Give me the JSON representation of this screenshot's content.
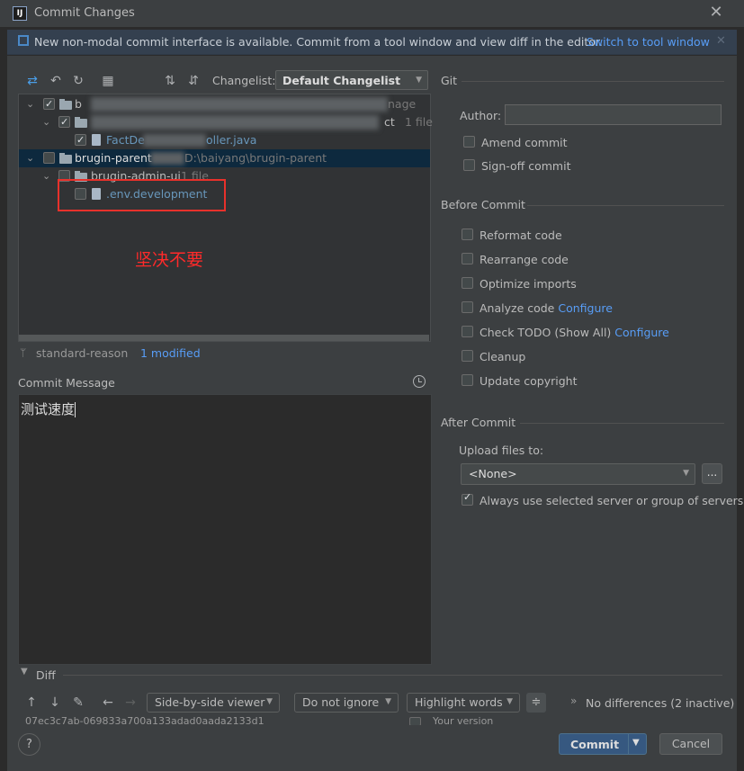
{
  "window": {
    "title": "Commit Changes",
    "app_icon": "IJ"
  },
  "banner": {
    "text": "New non-modal commit interface is available. Commit from a tool window and view diff in the editor.",
    "link": "Switch to tool window"
  },
  "toolbar": {
    "changelist_label": "Changelist:",
    "changelist_value": "Default Changelist"
  },
  "tree": {
    "rows": [
      {
        "text_left": "b",
        "text_right": "nage"
      },
      {
        "text_right": "ct",
        "count": "1 file"
      },
      {
        "file_left": "FactDe",
        "file_right": "oller.java"
      },
      {
        "name": "brugin-parent",
        "path": "D:\\baiyang\\brugin-parent"
      },
      {
        "name": "brugin-admin-ui",
        "count": "1 file"
      },
      {
        "name": ".env.development"
      }
    ]
  },
  "annotation": {
    "text": "坚决不要"
  },
  "status": {
    "branch": "standard-reason",
    "modified": "1 modified"
  },
  "commit_message": {
    "label": "Commit Message",
    "value": "测试速度"
  },
  "git": {
    "section_title": "Git",
    "author_label": "Author:",
    "author_value": "",
    "amend_label": "Amend commit",
    "signoff_label": "Sign-off commit"
  },
  "before_commit": {
    "title": "Before Commit",
    "reformat": "Reformat code",
    "rearrange": "Rearrange code",
    "optimize": "Optimize imports",
    "analyze": "Analyze code",
    "analyze_link": "Configure",
    "todo": "Check TODO (Show All)",
    "todo_link": "Configure",
    "cleanup": "Cleanup",
    "copyright": "Update copyright"
  },
  "after_commit": {
    "title": "After Commit",
    "upload_label": "Upload files to:",
    "upload_value": "<None>",
    "dots": "...",
    "always_label": "Always use selected server or group of servers"
  },
  "diff": {
    "label": "Diff",
    "viewer": "Side-by-side viewer",
    "ignore": "Do not ignore",
    "highlight": "Highlight words",
    "no_diff": "No differences (2 inactive)",
    "partial_left": "07ec3c7ab-069833a700a133adad0aada2133d1",
    "partial_right": "Your version"
  },
  "buttons": {
    "help": "?",
    "commit": "Commit",
    "cancel": "Cancel"
  },
  "colors": {
    "accent": "#589df6",
    "selection": "#0d293e",
    "annotation": "#e8312b",
    "commit_button": "#365880"
  }
}
